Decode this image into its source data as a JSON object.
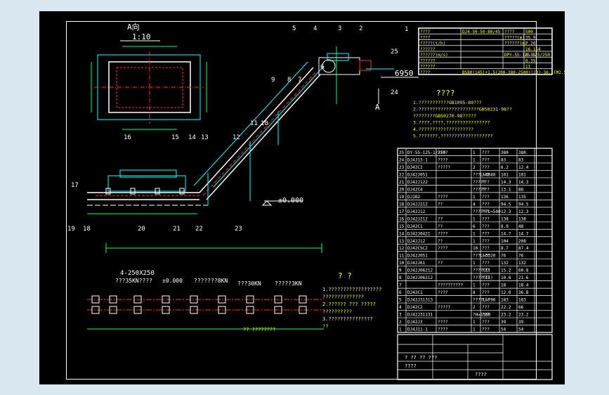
{
  "view_a": {
    "title": "A向",
    "scale": "1:10"
  },
  "callouts": [
    "1",
    "2",
    "3",
    "4",
    "5",
    "6",
    "7",
    "8",
    "9",
    "10",
    "11",
    "12",
    "13",
    "14",
    "15",
    "16",
    "17",
    "18",
    "19",
    "20",
    "21",
    "22",
    "23",
    "24",
    "25"
  ],
  "elevations": {
    "top": "6950",
    "zero": "±0.000",
    "section_mark": "A"
  },
  "spec_table": [
    [
      "????",
      "DJ4-50-50-80/45",
      "????",
      "500"
    ],
    [
      "????",
      "",
      "?????(m)",
      "35.9"
    ],
    [
      "?????(t/h)",
      "",
      "??????(m)",
      "7.26"
    ],
    [
      "??????",
      "",
      "",
      "16.154"
    ],
    [
      "??????(m/s)",
      "",
      "DPY-55-125-125/250",
      "6.35"
    ],
    [
      "??????",
      "",
      "",
      "6.35"
    ],
    [
      "??????",
      "",
      "",
      "11"
    ],
    [
      "????",
      "BS80(145)+1,5(200-380-2500)(20)-36.1(M2.5)",
      "",
      ""
    ]
  ],
  "notes_heading": "????",
  "notes": [
    "1.???????????GB1095-89???",
    "2.??????????????????????GB50231-98??",
    "????????GB50270-98?????",
    "3.????,????,????????????????",
    "4.????????????????????",
    "5.???????,???????????????????"
  ],
  "parts_list": [
    [
      "25",
      "DY-55-125-1/250",
      "????",
      "1",
      "???",
      "380",
      "380"
    ],
    [
      "24",
      "DJ4J13-1",
      "????",
      "1",
      "???",
      "83",
      "83"
    ],
    [
      "23",
      "DJ42C3",
      "?????",
      "2",
      "???",
      "6.2",
      "12.4"
    ],
    [
      "22",
      "DJ42J051",
      "",
      "???L=4040",
      "???",
      "101",
      "101"
    ],
    [
      "21",
      "DJ42J122",
      "",
      "?????",
      "???",
      "14.3",
      "14.3"
    ],
    [
      "20",
      "DJ42C4",
      "",
      "?????",
      "???",
      "13.1",
      "86"
    ],
    [
      "19",
      "DJ1B2",
      "????",
      "1",
      "???",
      "136",
      "135"
    ],
    [
      "18",
      "DJ42J212",
      "??",
      "4",
      "???",
      "94.5",
      "94.5"
    ],
    [
      "17",
      "DJ42J12",
      "",
      "??????L=500",
      "???",
      "12.3",
      "12.3"
    ],
    [
      "16",
      "DJ42J212",
      "??",
      "1",
      "???",
      "138",
      "138"
    ],
    [
      "15",
      "DJ42C1",
      "??",
      "6",
      "???",
      "8.0",
      "48"
    ],
    [
      "14",
      "DJ42J0421",
      "????",
      "1",
      "???",
      "14.7",
      "14.7"
    ],
    [
      "13",
      "DJ42J12",
      "??",
      "1",
      "???",
      "104",
      "208"
    ],
    [
      "12",
      "DJ42C5C2",
      "????",
      "10",
      "???",
      "8.7",
      "87.4"
    ],
    [
      "11",
      "DJ42J051",
      "",
      "???L=3320",
      "???",
      "76",
      "76"
    ],
    [
      "10",
      "DJ42J61",
      "??",
      "1",
      "???",
      "132",
      "132"
    ],
    [
      "9",
      "DJ42J06212",
      "",
      "????(I)",
      "???",
      "15.2",
      "60.8"
    ],
    [
      "8",
      "DJ42J06212",
      "",
      "????(II)",
      "???",
      "10.8",
      "21.6"
    ],
    [
      "7",
      "",
      "??????????",
      "1",
      "???",
      "18",
      "18.4"
    ],
    [
      "6",
      "DJ42C1",
      "????",
      "8",
      "???",
      "12.0",
      "36.8"
    ],
    [
      "5",
      "DJ42J31313",
      "",
      "????L=790",
      "???",
      "183",
      "183"
    ],
    [
      "4",
      "DJ42C2",
      "?????",
      "2",
      "???",
      "22.2",
      "66"
    ],
    [
      "3",
      "DJ42J31131",
      "",
      "?H=1180",
      "???",
      "23.2",
      "23.2"
    ],
    [
      "2",
      "DJ42J3",
      "????",
      "1",
      "???",
      "39",
      "39"
    ],
    [
      "1",
      "DJ4J11-1",
      "????",
      "1",
      "???",
      "54",
      "54"
    ]
  ],
  "foundation": {
    "title": "? ?",
    "size_label": "4-250X250",
    "elev_zero": "±0.000",
    "loads": [
      "???35KN????",
      "???????8KN",
      "???30KN",
      "?????3KN"
    ],
    "bottom_label": "?? ????????"
  },
  "foundation_notes": [
    "1.??????????????????",
    "??????????????",
    "2.?????? ??? ?????",
    "??????????",
    "3.???????????????",
    "??"
  ],
  "title_block": [
    "? ?? ?? ???",
    "????",
    "????"
  ]
}
